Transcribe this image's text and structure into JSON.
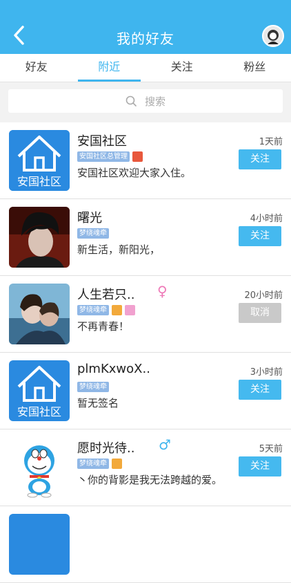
{
  "header": {
    "title": "我的好友"
  },
  "tabs": [
    {
      "label": "好友",
      "active": false
    },
    {
      "label": "附近",
      "active": true
    },
    {
      "label": "关注",
      "active": false
    },
    {
      "label": "粉丝",
      "active": false
    }
  ],
  "search": {
    "placeholder": "搜索"
  },
  "users": [
    {
      "name": "安国社区",
      "tags": [
        "安国社区总管理"
      ],
      "signature": "安国社区欢迎大家入住。",
      "time": "1天前",
      "action": "关注",
      "avatar": "house-logo"
    },
    {
      "name": "曙光",
      "tags": [
        "梦绕魂牵"
      ],
      "signature": "新生活，新阳光，",
      "time": "4小时前",
      "action": "关注",
      "avatar": "boy-photo"
    },
    {
      "name": "人生若只..",
      "tags": [
        "梦绕魂牵"
      ],
      "signature": "不再青春！",
      "time": "20小时前",
      "action": "取消",
      "gender": "female",
      "avatar": "couple-photo"
    },
    {
      "name": "plmKxwoX..",
      "tags": [
        "梦绕魂牵"
      ],
      "signature": "暂无签名",
      "time": "3小时前",
      "action": "关注",
      "avatar": "house-logo"
    },
    {
      "name": "愿时光待..",
      "tags": [
        "梦绕魂牵"
      ],
      "signature": "丶你的背影是我无法跨越的爱。",
      "time": "5天前",
      "action": "关注",
      "gender": "male",
      "avatar": "doraemon"
    }
  ],
  "house_logo_text": "安国社区",
  "colors": {
    "primary": "#3fb5ee",
    "tag": "#8fb7e6",
    "female": "#ee7ab8",
    "male": "#3fb5ee"
  }
}
